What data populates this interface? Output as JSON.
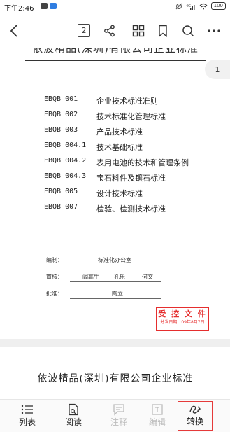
{
  "status_bar": {
    "time": "下午2:46",
    "battery": "100"
  },
  "toolbar": {
    "page_count": "2"
  },
  "document": {
    "header_cut_text": "依波精品(深圳)有限公司企业标准",
    "page_indicator": "1",
    "standards": [
      {
        "code": "EBQB 001",
        "name": "企业技术标准准则"
      },
      {
        "code": "EBQB 002",
        "name": "技术标准化管理标准"
      },
      {
        "code": "EBQB 003",
        "name": "产品技术标准"
      },
      {
        "code": "EBQB 004.1",
        "name": "技术基础标准"
      },
      {
        "code": "EBQB 004.2",
        "name": "表用电池的技术和管理条例"
      },
      {
        "code": "EBQB 004.3",
        "name": "宝石料件及镶石标准"
      },
      {
        "code": "EBQB 005",
        "name": "设计技术标准"
      },
      {
        "code": "EBQB 007",
        "name": "检验、检测技术标准"
      }
    ],
    "signoff": {
      "compiled_label": "编制：",
      "compiled_value": "标准化办公室",
      "reviewed_label": "审核：",
      "reviewers": [
        "阎高生",
        "孔乐",
        "何文"
      ],
      "approved_label": "批准：",
      "approver": "陶立"
    },
    "stamp": {
      "title": "受 控 文 件",
      "date": "分发日期：09年8月7日",
      "color": "#e52e2e"
    },
    "next_page_title": "依波精品(深圳)有限公司企业标准"
  },
  "bottom_bar": {
    "items": [
      {
        "label": "列表",
        "icon": "list-icon",
        "enabled": true
      },
      {
        "label": "阅读",
        "icon": "read-icon",
        "enabled": true
      },
      {
        "label": "注释",
        "icon": "comment-icon",
        "enabled": false
      },
      {
        "label": "编辑",
        "icon": "edit-icon",
        "enabled": false
      },
      {
        "label": "转换",
        "icon": "convert-icon",
        "enabled": true
      }
    ],
    "highlight_color": "#e53a3a"
  }
}
